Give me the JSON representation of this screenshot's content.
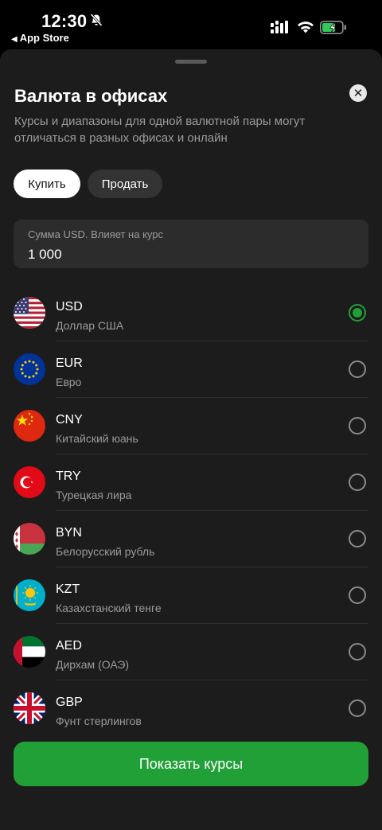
{
  "status_bar": {
    "time": "12:30",
    "back_app": "App Store"
  },
  "sheet": {
    "title": "Валюта в офисах",
    "subtitle": "Курсы и диапазоны для одной валютной пары могут отличаться в разных офисах и онлайн",
    "close_icon": "close-icon"
  },
  "segment": {
    "buy": "Купить",
    "sell": "Продать",
    "selected": "buy"
  },
  "amount": {
    "label": "Сумма USD. Влияет на курс",
    "value": "1 000"
  },
  "currencies": [
    {
      "code": "USD",
      "name": "Доллар США",
      "selected": true,
      "flag": "usa-flag-icon"
    },
    {
      "code": "EUR",
      "name": "Евро",
      "selected": false,
      "flag": "eu-flag-icon"
    },
    {
      "code": "CNY",
      "name": "Китайский юань",
      "selected": false,
      "flag": "china-flag-icon"
    },
    {
      "code": "TRY",
      "name": "Турецкая лира",
      "selected": false,
      "flag": "turkey-flag-icon"
    },
    {
      "code": "BYN",
      "name": "Белорусский рубль",
      "selected": false,
      "flag": "belarus-flag-icon"
    },
    {
      "code": "KZT",
      "name": "Казахстанский тенге",
      "selected": false,
      "flag": "kazakhstan-flag-icon"
    },
    {
      "code": "AED",
      "name": "Дирхам (ОАЭ)",
      "selected": false,
      "flag": "uae-flag-icon"
    },
    {
      "code": "GBP",
      "name": "Фунт стерлингов",
      "selected": false,
      "flag": "uk-flag-icon"
    }
  ],
  "cta": {
    "label": "Показать курсы"
  },
  "colors": {
    "accent": "#21a038",
    "sheet_bg": "#1c1c1c",
    "field_bg": "#2c2c2c",
    "secondary_text": "#9b9b9b"
  }
}
